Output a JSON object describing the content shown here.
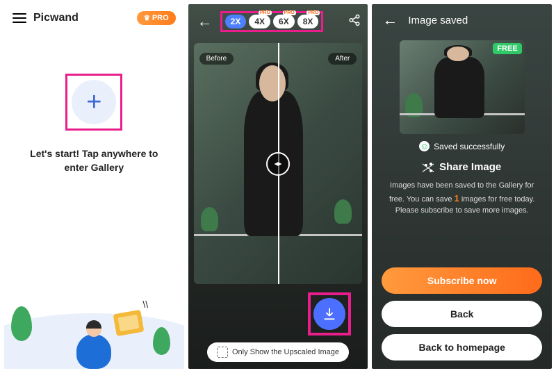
{
  "panel1": {
    "appName": "Picwand",
    "proBadge": "PRO",
    "startText": "Let's start! Tap anywhere to enter Gallery"
  },
  "panel2": {
    "zoomLevels": [
      "2X",
      "4X",
      "6X",
      "8X"
    ],
    "proTag": "PRO",
    "beforeLabel": "Before",
    "afterLabel": "After",
    "upscaleToggle": "Only Show the Upscaled Image"
  },
  "panel3": {
    "title": "Image saved",
    "freeBadge": "FREE",
    "savedStatus": "Saved successfully",
    "shareTitle": "Share Image",
    "infoPrefix": "Images have been saved to the Gallery for free. You can save ",
    "infoHighlight": "1",
    "infoSuffix": " images for free today. Please subscribe to save more images.",
    "subscribeBtn": "Subscribe now",
    "backBtn": "Back",
    "homeBtn": "Back to homepage"
  }
}
